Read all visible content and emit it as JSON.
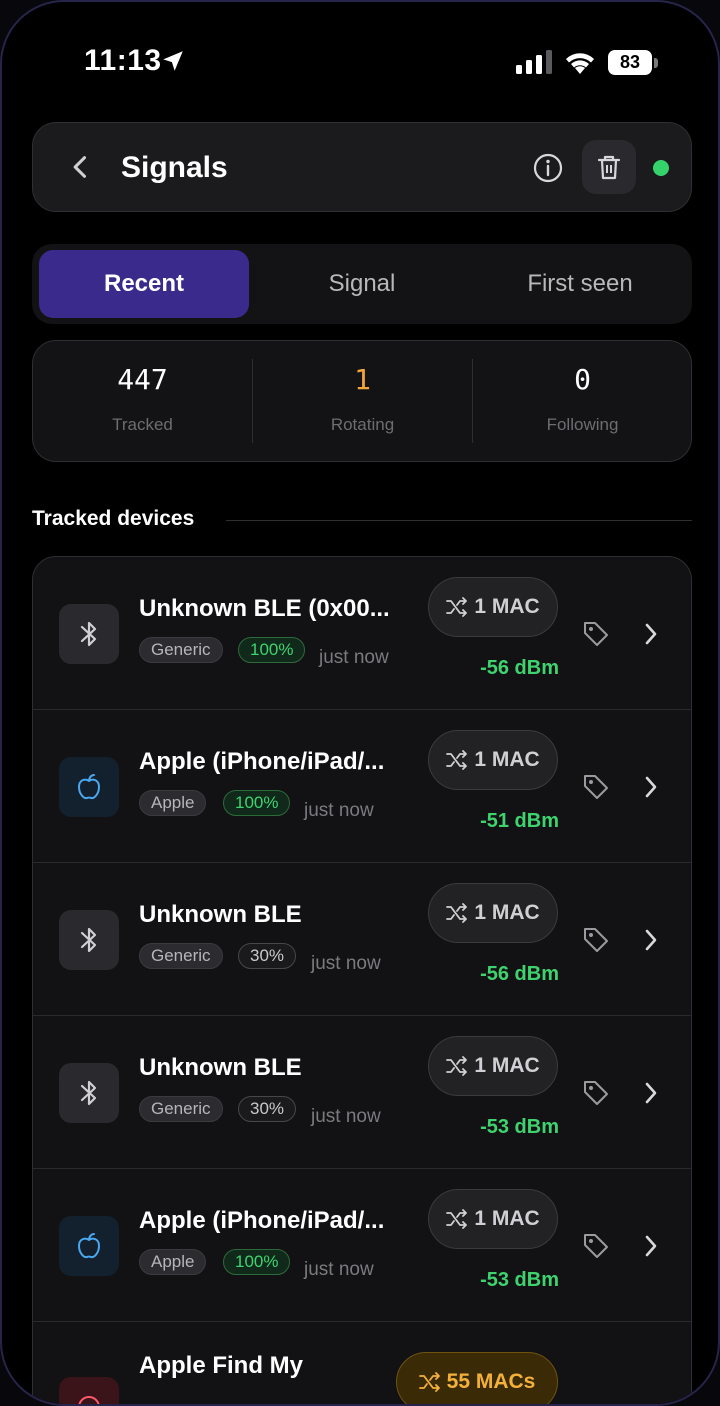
{
  "status_bar": {
    "time": "11:13",
    "battery": "83"
  },
  "header": {
    "title": "Signals"
  },
  "tabs": [
    {
      "label": "Recent",
      "active": true
    },
    {
      "label": "Signal",
      "active": false
    },
    {
      "label": "First seen",
      "active": false
    }
  ],
  "stats": [
    {
      "value": "447",
      "label": "Tracked",
      "color": "#ffffff"
    },
    {
      "value": "1",
      "label": "Rotating",
      "color": "#f3a63a"
    },
    {
      "value": "0",
      "label": "Following",
      "color": "#ffffff"
    }
  ],
  "section": {
    "title": "Tracked devices"
  },
  "devices": [
    {
      "icon": "bluetooth-icon",
      "name": "Unknown BLE (0x00...",
      "vendor": "Generic",
      "confidence": "100%",
      "seen": "just now",
      "macs": "1 MAC",
      "rssi": "-56 dBm"
    },
    {
      "icon": "apple-icon",
      "name": "Apple (iPhone/iPad/...",
      "vendor": "Apple",
      "confidence": "100%",
      "seen": "just now",
      "macs": "1 MAC",
      "rssi": "-51 dBm"
    },
    {
      "icon": "bluetooth-icon",
      "name": "Unknown BLE",
      "vendor": "Generic",
      "confidence": "30%",
      "seen": "just now",
      "macs": "1 MAC",
      "rssi": "-56 dBm"
    },
    {
      "icon": "bluetooth-icon",
      "name": "Unknown BLE",
      "vendor": "Generic",
      "confidence": "30%",
      "seen": "just now",
      "macs": "1 MAC",
      "rssi": "-53 dBm"
    },
    {
      "icon": "apple-icon",
      "name": "Apple (iPhone/iPad/...",
      "vendor": "Apple",
      "confidence": "100%",
      "seen": "just now",
      "macs": "1 MAC",
      "rssi": "-53 dBm"
    },
    {
      "icon": "findmy-icon",
      "name": "Apple Find My",
      "macs": "55 MACs"
    }
  ],
  "colors": {
    "accent": "#3a2a8c",
    "signal_good": "#3fd36f",
    "warning": "#f3b13a",
    "online": "#34d36b"
  }
}
